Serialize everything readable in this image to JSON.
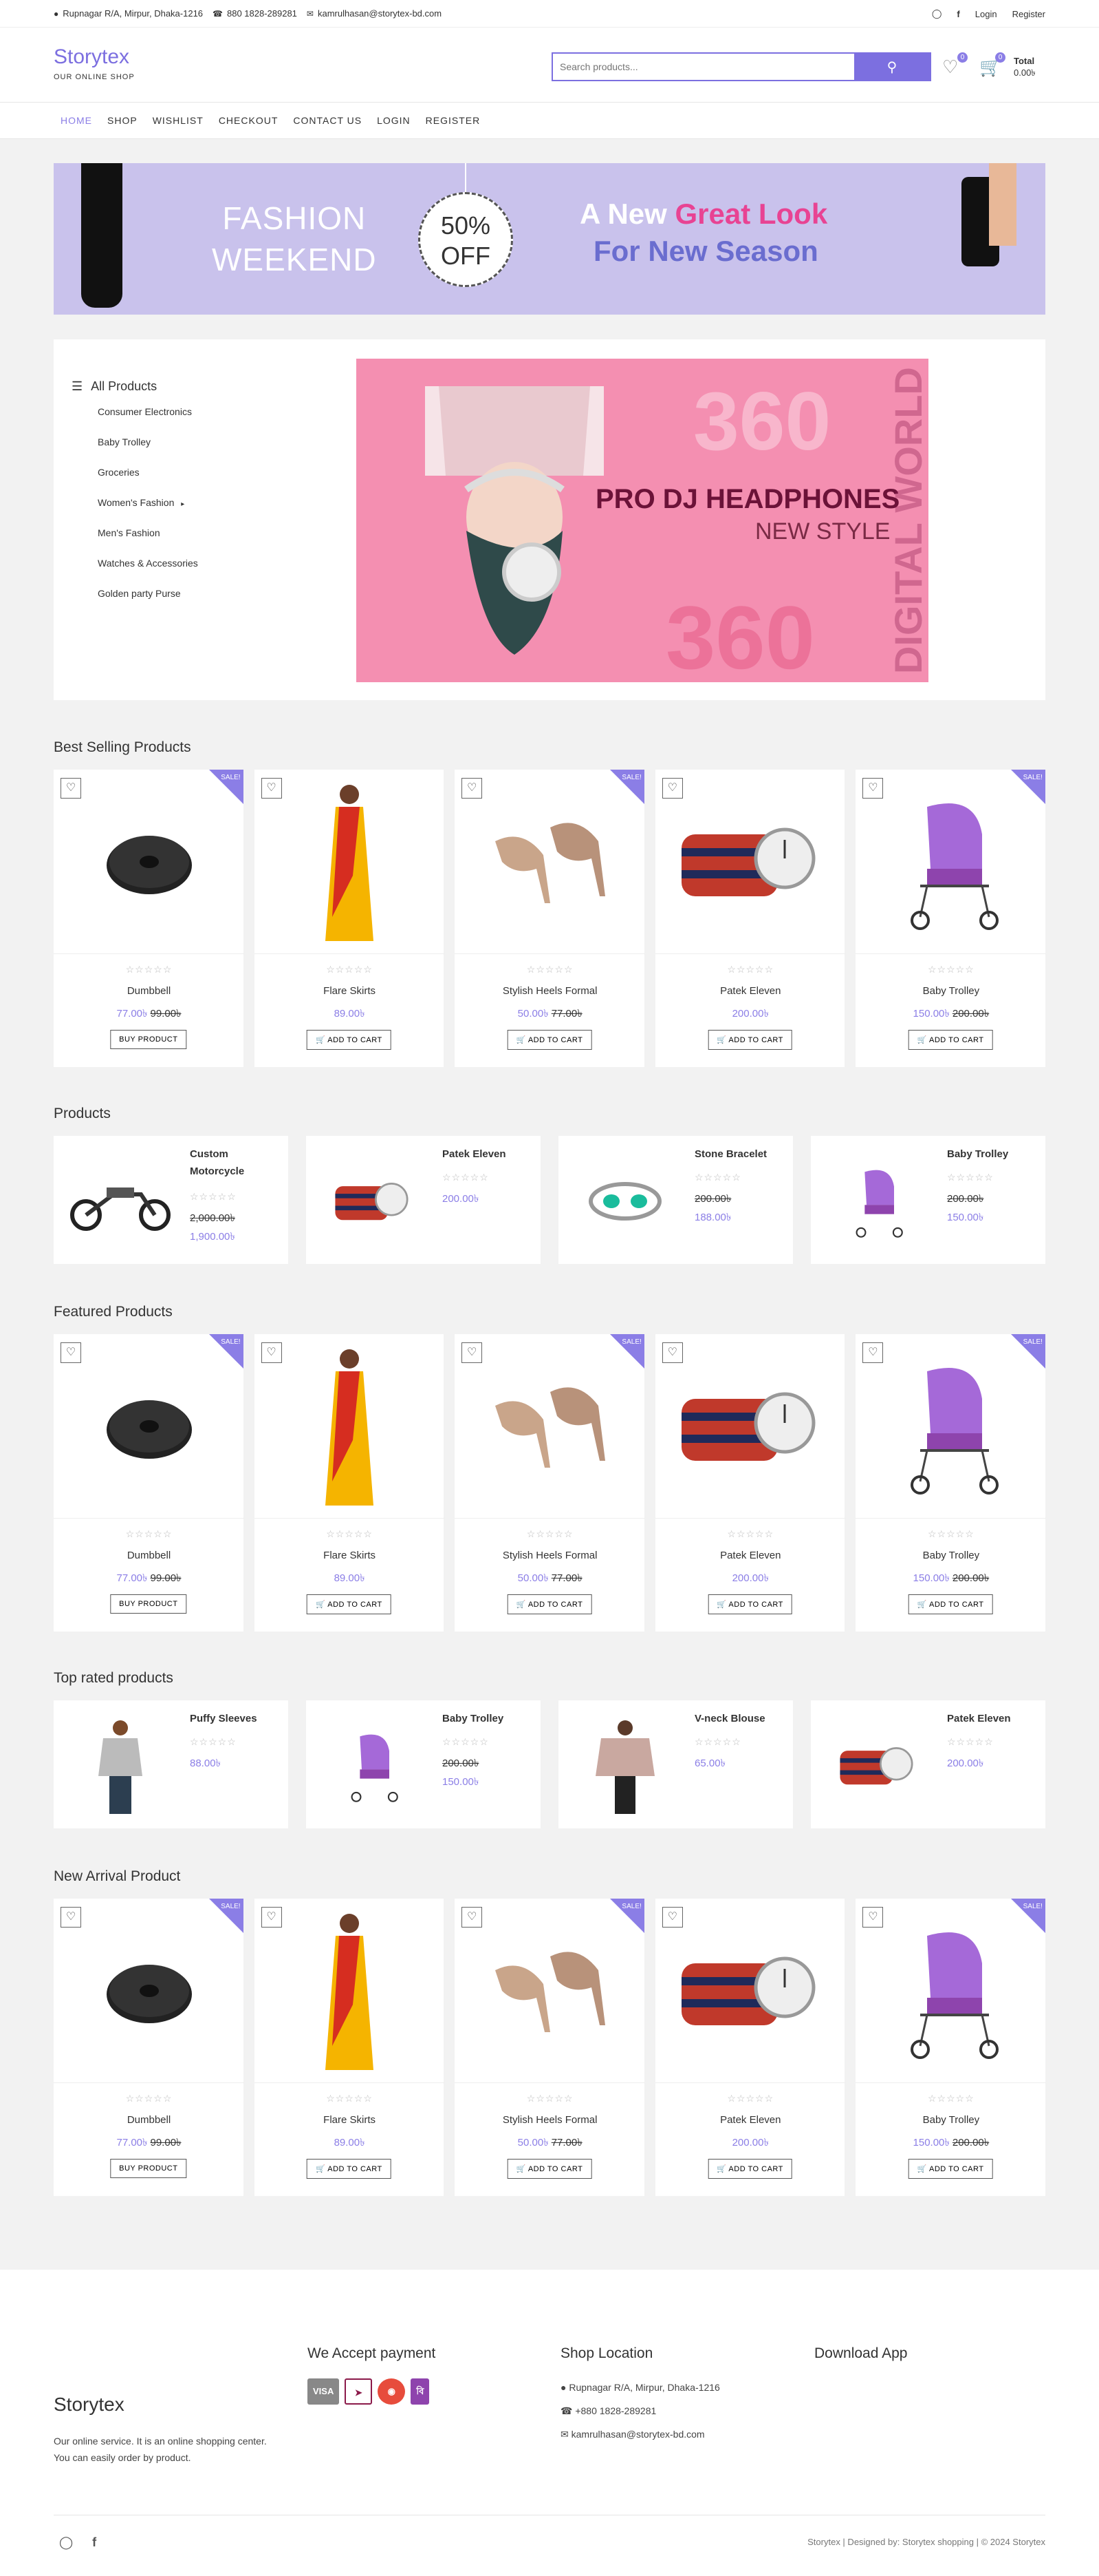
{
  "topbar": {
    "address": "Rupnagar R/A, Mirpur, Dhaka-1216",
    "phone": "880 1828-289281",
    "email": "kamrulhasan@storytex-bd.com",
    "login": "Login",
    "register": "Register"
  },
  "header": {
    "logo": "Storytex",
    "tagline": "OUR ONLINE SHOP",
    "search_placeholder": "Search products...",
    "wishlist_count": "0",
    "cart_count": "0",
    "total_label": "Total",
    "total_value": "0.00৳"
  },
  "nav": [
    "HOME",
    "SHOP",
    "WISHLIST",
    "CHECKOUT",
    "CONTACT US",
    "LOGIN",
    "REGISTER"
  ],
  "banner": {
    "line1": "FASHION",
    "line2": "WEEKEND",
    "pct": "50%",
    "off": "OFF",
    "a_new": "A New ",
    "great_look": "Great Look",
    "for_new": "For New Season"
  },
  "categories": {
    "title": "All Products",
    "items": [
      "Consumer Electronics",
      "Baby Trolley",
      "Groceries",
      "Women's Fashion",
      "Men's Fashion",
      "Watches & Accessories",
      "Golden party Purse"
    ]
  },
  "hero": {
    "num": "360",
    "title": "PRO DJ HEADPHONES",
    "subtitle": "NEW STYLE",
    "side": "DIGITAL WORLD"
  },
  "sections": {
    "best_selling": "Best Selling Products",
    "products": "Products",
    "featured": "Featured Products",
    "top_rated": "Top rated products",
    "new_arrival": "New Arrival Product"
  },
  "sale_label": "SALE!",
  "product_cards": [
    {
      "name": "Dumbbell",
      "price": "77.00৳",
      "old": "99.00৳",
      "btn": "BUY PRODUCT",
      "sale": true,
      "icon": "dumbbell-plate-icon"
    },
    {
      "name": "Flare Skirts",
      "price": "89.00৳",
      "old": "",
      "btn": "ADD TO CART",
      "sale": false,
      "icon": "saree-icon"
    },
    {
      "name": "Stylish Heels Formal",
      "price": "50.00৳",
      "old": "77.00৳",
      "btn": "ADD TO CART",
      "sale": true,
      "icon": "heels-icon"
    },
    {
      "name": "Patek Eleven",
      "price": "200.00৳",
      "old": "",
      "btn": "ADD TO CART",
      "sale": false,
      "icon": "watch-icon"
    },
    {
      "name": "Baby Trolley",
      "price": "150.00৳",
      "old": "200.00৳",
      "btn": "ADD TO CART",
      "sale": true,
      "icon": "stroller-icon"
    }
  ],
  "products_small": [
    {
      "name": "Custom Motorcycle",
      "price": "1,900.00৳",
      "old": "2,000.00৳"
    },
    {
      "name": "Patek Eleven",
      "price": "200.00৳",
      "old": ""
    },
    {
      "name": "Stone Bracelet",
      "price": "188.00৳",
      "old": "200.00৳"
    },
    {
      "name": "Baby Trolley",
      "price": "150.00৳",
      "old": "200.00৳"
    }
  ],
  "top_rated_small": [
    {
      "name": "Puffy Sleeves",
      "price": "88.00৳",
      "old": ""
    },
    {
      "name": "Baby Trolley",
      "price": "150.00৳",
      "old": "200.00৳"
    },
    {
      "name": "V-neck Blouse",
      "price": "65.00৳",
      "old": ""
    },
    {
      "name": "Patek Eleven",
      "price": "200.00৳",
      "old": ""
    }
  ],
  "footer": {
    "logo": "Storytex",
    "desc": "Our online service. It is an online shopping center. You can easily order by product.",
    "pay_title": "We Accept payment",
    "pay_methods": [
      "VISA",
      "Rocket",
      "Nagad",
      "bKash"
    ],
    "loc_title": "Shop Location",
    "loc_address": "Rupnagar R/A, Mirpur, Dhaka-1216",
    "loc_phone": "+880 1828-289281",
    "loc_email": "kamrulhasan@storytex-bd.com",
    "app_title": "Download App",
    "copyright": "Storytex | Designed by: Storytex shopping | © 2024 Storytex"
  },
  "colors": {
    "accent": "#8b7ee6",
    "logo": "#7c6fe0"
  }
}
